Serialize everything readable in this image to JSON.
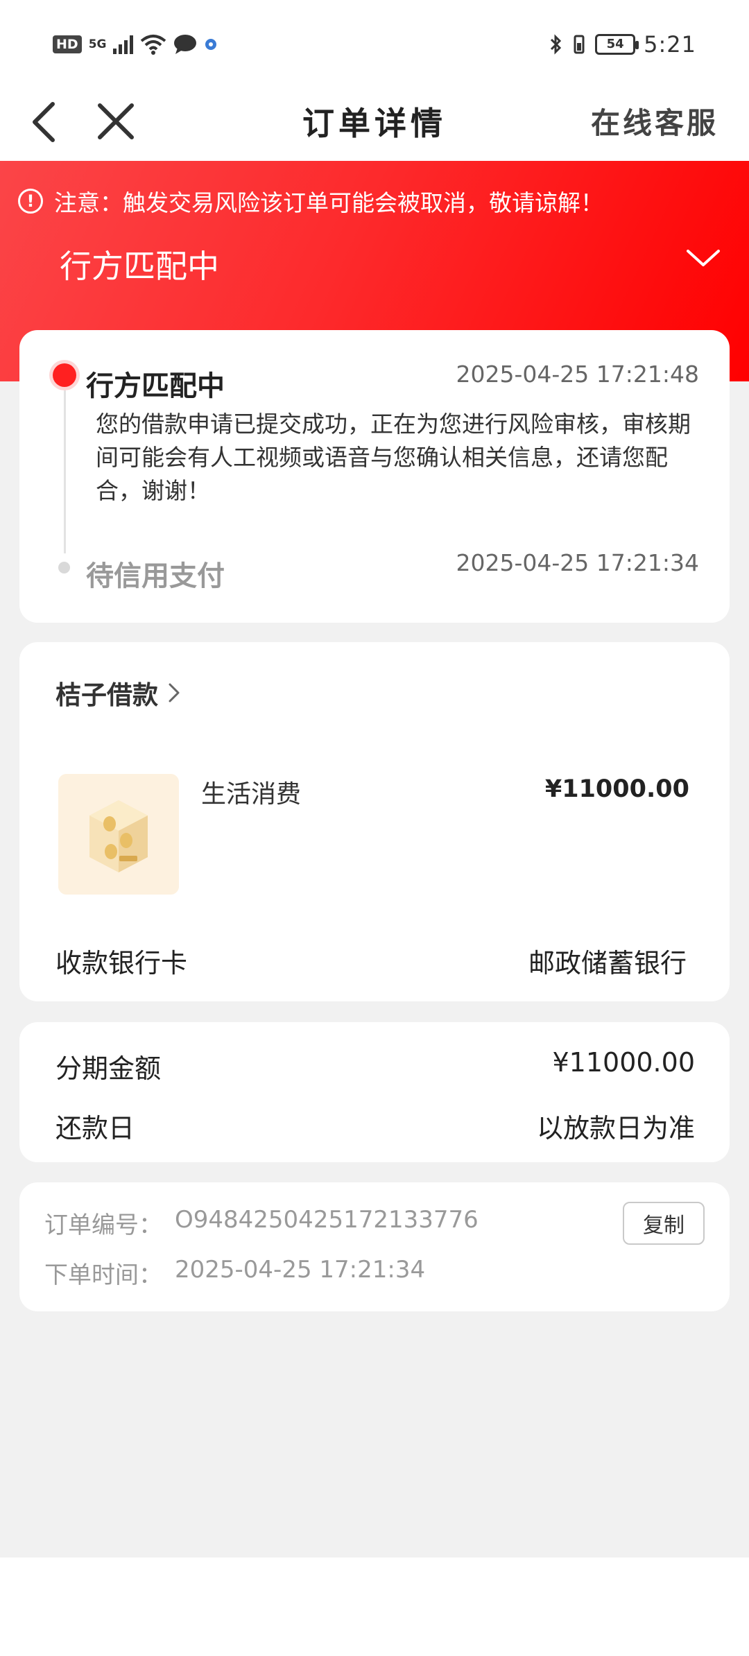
{
  "status_bar": {
    "hd_label": "HD",
    "network_label": "5G",
    "time": "5:21",
    "battery": "54"
  },
  "nav": {
    "title": "订单详情",
    "service_label": "在线客服"
  },
  "banner": {
    "notice_icon": "!",
    "notice_text": "注意：触发交易风险该订单可能会被取消，敬请谅解！",
    "status_title": "行方匹配中"
  },
  "timeline": {
    "steps": [
      {
        "title": "行方匹配中",
        "time": "2025-04-25 17:21:48",
        "description": "您的借款申请已提交成功，正在为您进行风险审核，审核期间可能会有人工视频或语音与您确认相关信息，还请您配合，谢谢！"
      },
      {
        "title": "待信用支付",
        "time": "2025-04-25 17:21:34"
      }
    ]
  },
  "product": {
    "store_name": "桔子借款",
    "item_name": "生活消费",
    "price": "¥11000.00",
    "bank_label": "收款银行卡",
    "bank_value": "邮政储蓄银行"
  },
  "amount": {
    "installment_label": "分期金额",
    "installment_value": "¥11000.00",
    "due_label": "还款日",
    "due_value": "以放款日为准"
  },
  "order": {
    "number_label": "订单编号：",
    "number_value": "O948425042517213377​6",
    "time_label": "下单时间：",
    "time_value": "2025-04-25 17:21:34",
    "copy_label": "复制"
  },
  "colors": {
    "accent_red": "#ff0000",
    "banner_start": "#fb4548",
    "background": "#f1f1f1"
  }
}
